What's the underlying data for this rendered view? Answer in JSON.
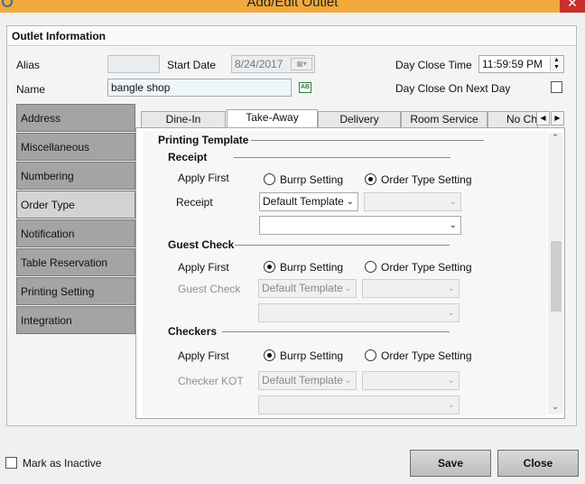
{
  "window": {
    "title": "Add/Edit Outlet",
    "close_glyph": "✕"
  },
  "panel": {
    "header": "Outlet Information"
  },
  "fields": {
    "alias_label": "Alias",
    "alias_value": "",
    "start_date_label": "Start Date",
    "start_date_value": "8/24/2017",
    "name_label": "Name",
    "name_value": "bangle shop",
    "name_button": "AB",
    "day_close_time_label": "Day Close Time",
    "day_close_time_value": "11:59:59 PM",
    "day_close_next_day_label": "Day Close On Next Day",
    "day_close_next_day_checked": false
  },
  "sidebar": {
    "items": [
      {
        "label": "Address"
      },
      {
        "label": "Miscellaneous"
      },
      {
        "label": "Numbering"
      },
      {
        "label": "Order Type",
        "selected": true
      },
      {
        "label": "Notification"
      },
      {
        "label": "Table Reservation"
      },
      {
        "label": "Printing Setting"
      },
      {
        "label": "Integration"
      }
    ]
  },
  "tabs": [
    {
      "label": "Dine-In"
    },
    {
      "label": "Take-Away",
      "active": true
    },
    {
      "label": "Delivery"
    },
    {
      "label": "Room Service"
    },
    {
      "label": "No Ch"
    }
  ],
  "printing_template": {
    "title": "Printing Template",
    "receipt": {
      "title": "Receipt",
      "apply_first_label": "Apply First",
      "option_burrp": "Burrp Setting",
      "option_order_type": "Order Type Setting",
      "selected": "order_type",
      "field_label": "Receipt",
      "template_value": "Default Template",
      "second_value": "",
      "third_value": ""
    },
    "guest_check": {
      "title": "Guest Check",
      "apply_first_label": "Apply First",
      "option_burrp": "Burrp Setting",
      "option_order_type": "Order Type Setting",
      "selected": "burrp",
      "field_label": "Guest Check",
      "template_value": "Default Template"
    },
    "checkers": {
      "title": "Checkers",
      "apply_first_label": "Apply First",
      "option_burrp": "Burrp Setting",
      "option_order_type": "Order Type Setting",
      "selected": "burrp",
      "field_label": "Checker KOT",
      "template_value": "Default Template"
    }
  },
  "footer": {
    "inactive_label": "Mark as Inactive",
    "inactive_checked": false,
    "save_label": "Save",
    "close_label": "Close"
  },
  "colors": {
    "titlebar": "#f2a93b",
    "close_button": "#c9302c",
    "sidebar_item": "#a4a4a4",
    "sidebar_selected": "#d3d3d3"
  }
}
